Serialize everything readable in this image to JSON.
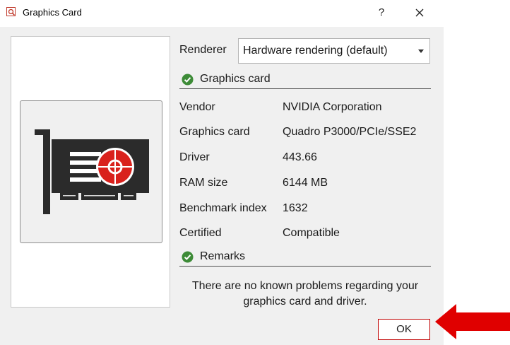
{
  "window": {
    "title": "Graphics Card",
    "app_icon": "search-icon",
    "help_label": "?",
    "close_icon": "close-icon"
  },
  "image_panel": {
    "icon": "graphics-card-icon",
    "colors": {
      "card_body": "#2b2b2b",
      "fan": "#d9211c",
      "tile_border": "#8c8c8c"
    }
  },
  "renderer": {
    "label": "Renderer",
    "selected": "Hardware rendering (default)"
  },
  "graphics_card_section": {
    "title": "Graphics card",
    "status_icon": "check-circle-icon",
    "status_color": "#3d8b37"
  },
  "info_rows": [
    {
      "key": "Vendor",
      "value": "NVIDIA Corporation"
    },
    {
      "key": "Graphics card",
      "value": "Quadro P3000/PCIe/SSE2"
    },
    {
      "key": "Driver",
      "value": "443.66"
    },
    {
      "key": "RAM size",
      "value": "6144 MB"
    },
    {
      "key": "Benchmark index",
      "value": "1632"
    },
    {
      "key": "Certified",
      "value": "Compatible"
    }
  ],
  "remarks_section": {
    "title": "Remarks",
    "status_icon": "check-circle-icon",
    "line1": "There are no known problems regarding your",
    "line2": "graphics card and driver."
  },
  "footer": {
    "ok_label": "OK",
    "annotation": "red-arrow-icon",
    "annotation_color": "#e00000"
  }
}
